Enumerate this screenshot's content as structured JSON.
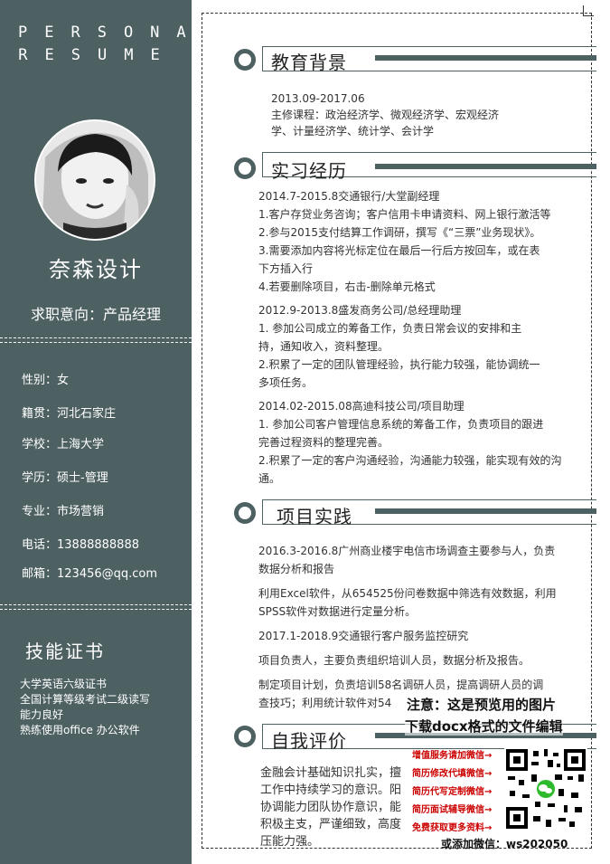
{
  "sidebar": {
    "title_letters": "PERSONAL RESUME",
    "name": "奈森设计",
    "intent": "求职意向：产品经理",
    "info": {
      "gender": "性别：女",
      "native": "籍贯：河北石家庄",
      "school": "学校：上海大学",
      "degree": "学历：硕士-管理",
      "major": "专业：市场营销",
      "phone": "电话：13888888888",
      "email": "邮箱：123456@qq.com"
    },
    "skills_title": "技能证书",
    "skills": [
      "大学英语六级证书",
      "全国计算等级考试二级读写",
      "能力良好",
      "熟练使用office 办公软件"
    ]
  },
  "sections": {
    "education": {
      "title": "教育背景",
      "lines": [
        "2013.09-2017.06",
        "主修课程：政治经济学、微观经济学、宏观经济",
        "学、计量经济学、统计学、会计学"
      ]
    },
    "internship": {
      "title": "实习经历",
      "lines": [
        "2014.7-2015.8交通银行/大堂副经理",
        "1.客户存贷业务咨询；客户信用卡申请资料、网上银行激活等",
        "2.参与2015支付结算工作调研，撰写《“三票”业务现状》。",
        "3.需要添加内容将光标定位在最后一行后方按回车，或在表",
        "下方插入行",
        "4.若要删除项目，右击-删除单元格式",
        "2012.9-2013.8盛发商务公司/总经理助理",
        "1. 参加公司成立的筹备工作，负责日常会议的安排和主",
        "持，通知收入，资料整理。",
        "2.积累了一定的团队管理经验，执行能力较强，能协调统一",
        "多项任务。",
        "2014.02-2015.08高迪科技公司/项目助理",
        "1. 参加公司客户管理信息系统的筹备工作，负责项目的跟进",
        "完善过程资料的整理完善。",
        "2.积累了一定的客户沟通经验，沟通能力较强，能实现有效的沟",
        "通。"
      ]
    },
    "project": {
      "title": "项目实践",
      "lines": [
        "2016.3-2016.8广州商业楼宇电信市场调查主要参与人，负责",
        "数据分析和报告",
        "利用Excel软件，从654525份问卷数据中筛选有效数据，利用",
        "SPSS软件对数据进行定量分析。",
        "2017.1-2018.9交通银行客户服务监控研究",
        "项目负责人，主要负责组织培训人员，数据分析及报告。",
        "制定项目计划，负责培训58名调研人员，提高调研人员的调",
        "查技巧；利用统计软件对54"
      ]
    },
    "self": {
      "title": "自我评价",
      "lines": [
        "金融会计基础知识扎实，擅",
        "工作中持续学习的意识。阳",
        "协调能力团队协作意识，能",
        "积极主支，严谨细致，高度",
        "压能力强。"
      ]
    }
  },
  "watermark": {
    "line1": "注意：这是预览用的图片",
    "line2": "下载docx格式的文件编辑",
    "items": [
      "增值服务请加微信→",
      "简历修改代填微信→",
      "简历代写定制微信→",
      "简历面试辅导微信→",
      "免费获取更多资料→"
    ],
    "wechat": "或添加微信：ws202050"
  },
  "colors": {
    "sidebar": "#4d6062",
    "accent": "#4d6062",
    "watermark_red": "#c00000"
  }
}
